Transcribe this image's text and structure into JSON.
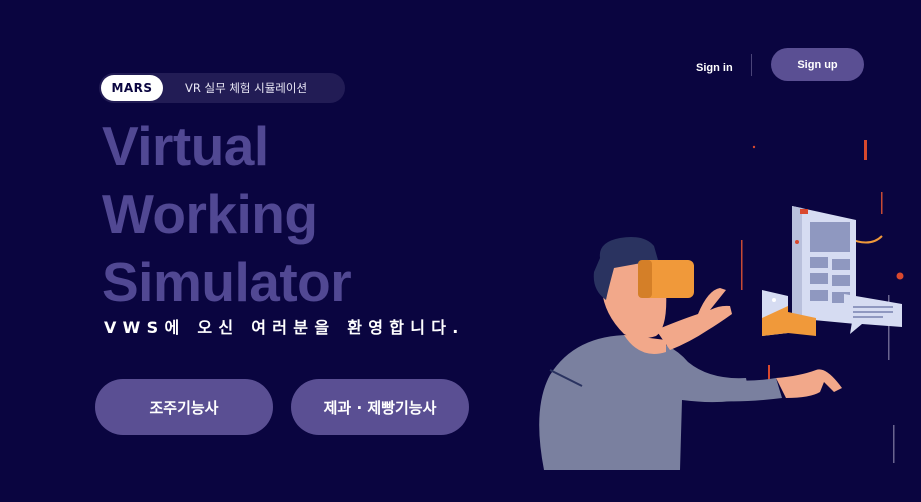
{
  "badge": {
    "label": "MARS",
    "subtitle": "VR 실무 체험 시뮬레이션"
  },
  "hero": {
    "line1": "Virtual",
    "line2": "Working",
    "line3": "Simulator",
    "welcome": "VWS에 오신 여러분을 환영합니다."
  },
  "buttons": {
    "primary": "조주기능사",
    "secondary": "제과 · 제빵기능사"
  },
  "nav": {
    "signin": "Sign in",
    "signup": "Sign up"
  },
  "colors": {
    "background": "#0a0540",
    "accent": "#5a4f93",
    "hero_text": "#514893",
    "headset": "#f0993a",
    "skin": "#f2a88a"
  },
  "icons": [
    "vr-person-illustration"
  ]
}
